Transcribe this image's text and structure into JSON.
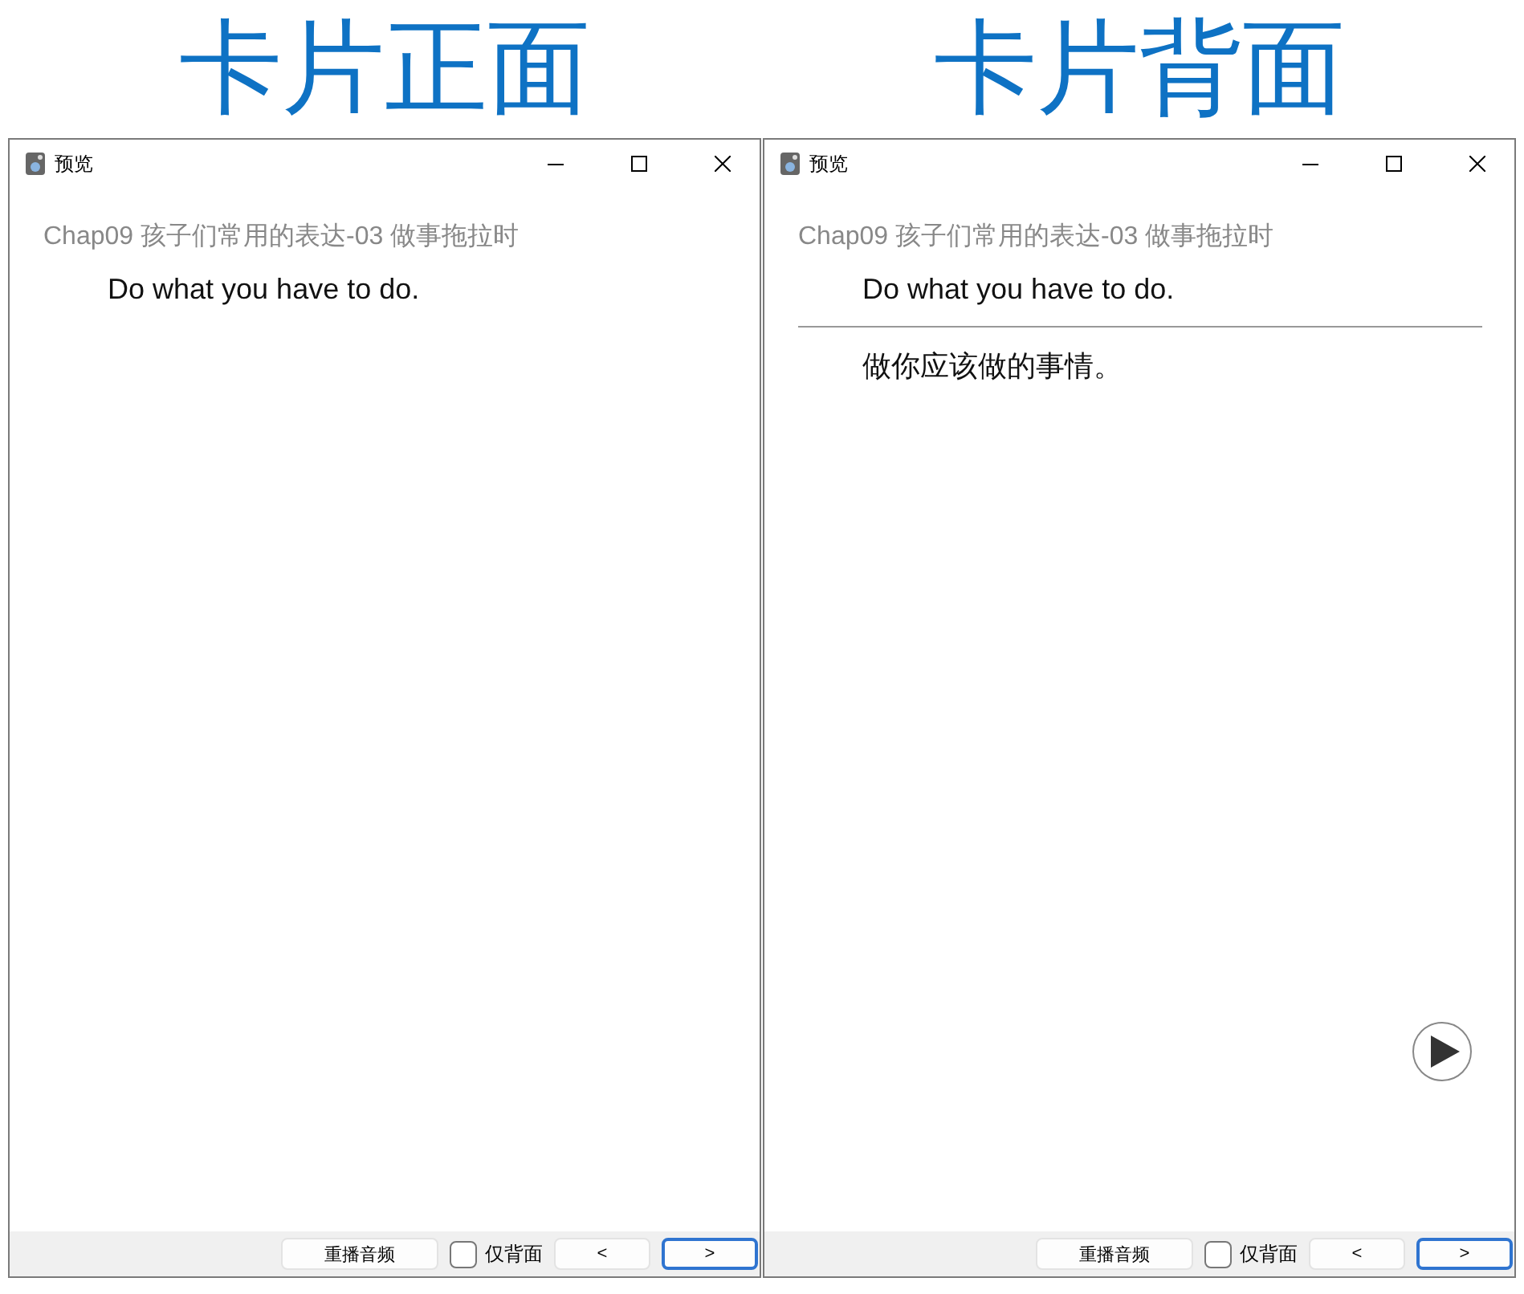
{
  "panels": [
    {
      "heading": "卡片正面",
      "window": {
        "title": "预览"
      },
      "deck": "Chap09 孩子们常用的表达-03 做事拖拉时",
      "front": "Do what you have to do.",
      "show_play": false,
      "bottom_bar": {
        "replay": "重播音频",
        "back_only": {
          "label": "仅背面",
          "checked": false
        },
        "nav": [
          {
            "label": "<",
            "focused": false
          },
          {
            "label": ">",
            "focused": true
          }
        ]
      }
    },
    {
      "heading": "卡片背面",
      "window": {
        "title": "预览"
      },
      "deck": "Chap09 孩子们常用的表达-03 做事拖拉时",
      "front": "Do what you have to do.",
      "back": "做你应该做的事情。",
      "show_play": true,
      "bottom_bar": {
        "replay": "重播音频",
        "back_only": {
          "label": "仅背面",
          "checked": false
        },
        "nav": [
          {
            "label": "<",
            "focused": false
          },
          {
            "label": ">",
            "focused": true
          }
        ]
      }
    }
  ]
}
